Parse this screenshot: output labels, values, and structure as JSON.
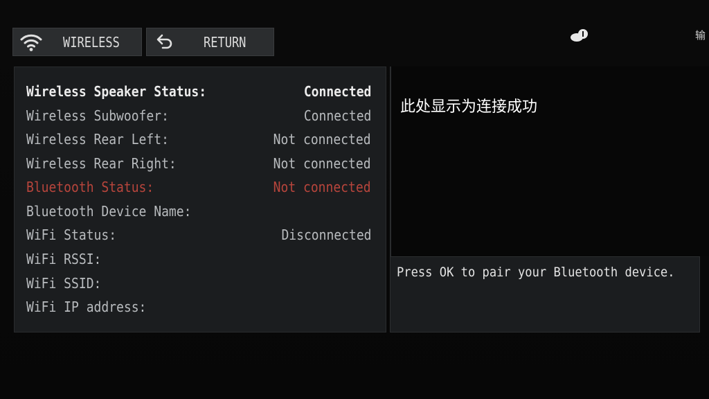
{
  "toolbar": {
    "wireless_label": "WIRELESS",
    "return_label": "RETURN"
  },
  "corner": {
    "text": "输"
  },
  "status_list": [
    {
      "label": "Wireless Speaker Status:",
      "value": "Connected"
    },
    {
      "label": "Wireless Subwoofer:",
      "value": "Connected"
    },
    {
      "label": "Wireless Rear Left:",
      "value": "Not connected"
    },
    {
      "label": "Wireless Rear Right:",
      "value": "Not connected"
    },
    {
      "label": "Bluetooth Status:",
      "value": "Not connected"
    },
    {
      "label": "Bluetooth Device Name:",
      "value": ""
    },
    {
      "label": "WiFi Status:",
      "value": "Disconnected"
    },
    {
      "label": "WiFi RSSI:",
      "value": ""
    },
    {
      "label": "WiFi SSID:",
      "value": ""
    },
    {
      "label": "WiFi IP address:",
      "value": ""
    }
  ],
  "overlay_note": "此处显示为连接成功",
  "hint_text": "Press OK to pair your Bluetooth device.",
  "icons": {
    "wireless": "wifi-icon",
    "return": "return-arrow-icon",
    "corner": "input-source-icon"
  },
  "colors": {
    "background": "#050505",
    "panel": "#1b1d1f",
    "button": "#2b2d2f",
    "highlight_text": "#ececec",
    "normal_text": "#b9bcbf",
    "alert_red": "#b8453c"
  }
}
